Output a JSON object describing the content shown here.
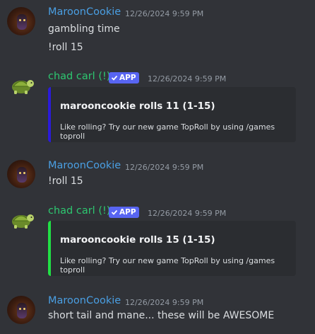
{
  "colors": {
    "background": "#313338",
    "maroon_name": "#4a9fe3",
    "chad_name": "#2dc770",
    "app_badge": "#5865f2",
    "embed1_accent": "#2b1bd9",
    "embed2_accent": "#21e045"
  },
  "messages": [
    {
      "author": "MaroonCookie",
      "timestamp": "12/26/2024 9:59 PM",
      "avatar_icon": "minecraft-character-avatar",
      "lines": [
        "gambling time",
        "!roll 15"
      ]
    },
    {
      "author": "chad carl (!)",
      "badge": "APP",
      "badge_icon": "checkmark-icon",
      "timestamp": "12/26/2024 9:59 PM",
      "avatar_icon": "turtle-avatar",
      "embed": {
        "title": "marooncookie rolls 11 (1-15)",
        "description": "Like rolling? Try our new game TopRoll by using /games toproll"
      }
    },
    {
      "author": "MaroonCookie",
      "timestamp": "12/26/2024 9:59 PM",
      "avatar_icon": "minecraft-character-avatar",
      "lines": [
        "!roll 15"
      ]
    },
    {
      "author": "chad carl (!)",
      "badge": "APP",
      "badge_icon": "checkmark-icon",
      "timestamp": "12/26/2024 9:59 PM",
      "avatar_icon": "turtle-avatar",
      "embed": {
        "title": "marooncookie rolls 15 (1-15)",
        "description": "Like rolling? Try our new game TopRoll by using /games toproll"
      }
    },
    {
      "author": "MaroonCookie",
      "timestamp": "12/26/2024 9:59 PM",
      "avatar_icon": "minecraft-character-avatar",
      "lines": [
        "short tail and mane... these will be AWESOME"
      ]
    }
  ]
}
